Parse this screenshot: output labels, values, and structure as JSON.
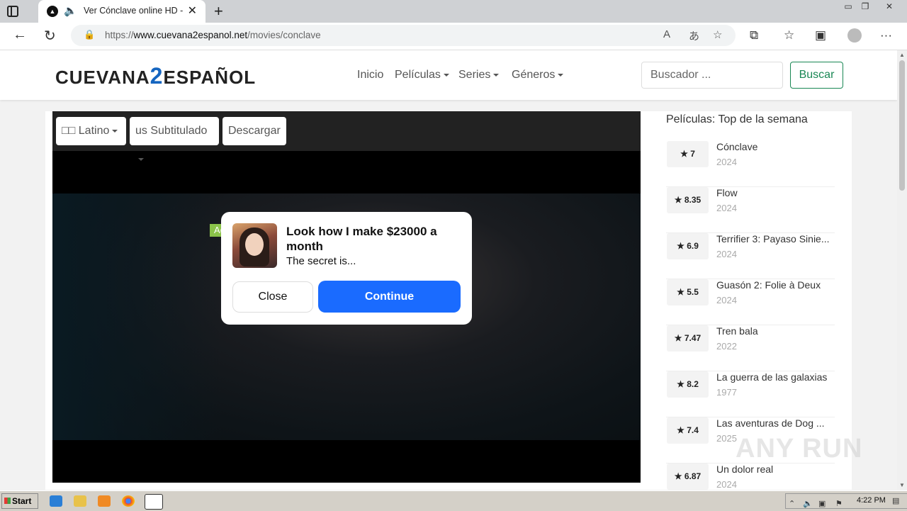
{
  "browser": {
    "tab_title": "Ver Cónclave online HD - C",
    "url_prefix": "https://",
    "url_domain": "www.cuevana2espanol.net",
    "url_path": "/movies/conclave"
  },
  "site": {
    "logo_left": "CUEVANA",
    "logo_mid": "2",
    "logo_right": "ESPAÑOL",
    "nav": {
      "inicio": "Inicio",
      "peliculas": "Películas",
      "series": "Series",
      "generos": "Géneros"
    },
    "search_placeholder": "Buscador ...",
    "search_button": "Buscar"
  },
  "player": {
    "lang_button": "□□ Latino",
    "sub_button": "us Subtitulado",
    "download_button": "Descargar"
  },
  "ad": {
    "tag": "Ad",
    "title": "Look how I make $23000 a month",
    "subtitle": "The secret is...",
    "close": "Close",
    "continue": "Continue"
  },
  "sidebar": {
    "title": "Películas: Top de la semana",
    "items": [
      {
        "rating": "★ 7",
        "name": "Cónclave",
        "year": "2024"
      },
      {
        "rating": "★ 8.35",
        "name": "Flow",
        "year": "2024"
      },
      {
        "rating": "★ 6.9",
        "name": "Terrifier 3: Payaso Sinie...",
        "year": "2024"
      },
      {
        "rating": "★ 5.5",
        "name": "Guasón 2: Folie à Deux",
        "year": "2024"
      },
      {
        "rating": "★ 7.47",
        "name": "Tren bala",
        "year": "2022"
      },
      {
        "rating": "★ 8.2",
        "name": "La guerra de las galaxias",
        "year": "1977"
      },
      {
        "rating": "★ 7.4",
        "name": "Las aventuras de Dog ...",
        "year": "2025"
      },
      {
        "rating": "★ 6.87",
        "name": "Un dolor real",
        "year": "2024"
      }
    ]
  },
  "watermark": "ANY RUN",
  "taskbar": {
    "start": "Start",
    "clock": "4:22 PM"
  }
}
